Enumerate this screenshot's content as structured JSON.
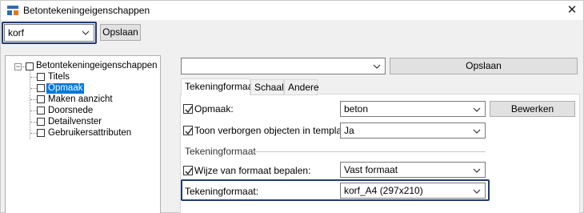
{
  "window": {
    "title": "Betontekeningeigenschappen",
    "close_glyph": "✕"
  },
  "toolbar": {
    "preset_value": "korf",
    "save_label": "Opslaan"
  },
  "tree": {
    "root_label": "Betontekeningeigenschappen",
    "items": [
      {
        "label": "Titels"
      },
      {
        "label": "Opmaak",
        "selected": true
      },
      {
        "label": "Maken aanzicht"
      },
      {
        "label": "Doorsnede"
      },
      {
        "label": "Detailvenster"
      },
      {
        "label": "Gebruikersattributen"
      }
    ]
  },
  "right": {
    "preset_value": "",
    "save_label": "Opslaan",
    "tabs": [
      {
        "label": "Tekeningformaat",
        "active": true
      },
      {
        "label": "Schaal"
      },
      {
        "label": "Andere"
      }
    ],
    "rows": {
      "opmaak_label": "Opmaak:",
      "opmaak_value": "beton",
      "edit_label": "Bewerken",
      "verborgen_label": "Toon verborgen objecten in templates",
      "verborgen_value": "Ja",
      "section_label": "Tekeningformaat",
      "wijze_label": "Wijze van formaat bepalen:",
      "wijze_value": "Vast formaat",
      "formaat_label": "Tekeningformaat:",
      "formaat_value": "korf_A4 (297x210)"
    }
  },
  "colors": {
    "highlight": "#1f3c6e",
    "selection": "#0078d7"
  }
}
